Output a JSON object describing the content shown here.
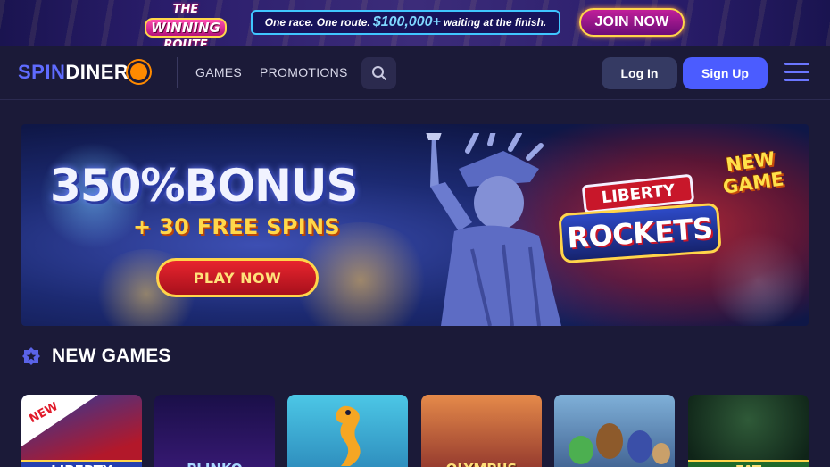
{
  "promo": {
    "logo_line1": "THE",
    "logo_line2": "WINNING",
    "logo_line3": "ROUTE",
    "tagline_before": "One race. One route.",
    "tagline_amount": "$100,000+",
    "tagline_after": "waiting at the finish.",
    "join_label": "JOIN NOW"
  },
  "header": {
    "brand_spin": "SPIN",
    "brand_dinero": "DINER",
    "nav": [
      {
        "label": "GAMES"
      },
      {
        "label": "PROMOTIONS"
      }
    ],
    "login_label": "Log In",
    "signup_label": "Sign Up"
  },
  "hero": {
    "bonus_text": "350%BONUS",
    "spins_text": "+ 30 FREE SPINS",
    "play_label": "PLAY NOW",
    "game_word1": "LIBERTY",
    "game_word2": "ROCKETS",
    "badge_line1": "NEW",
    "badge_line2": "GAME"
  },
  "section": {
    "title": "NEW GAMES"
  },
  "tiles": [
    {
      "label": "LIBERTY",
      "ribbon": "NEW",
      "color": "#b3182a"
    },
    {
      "label": "PLINKO",
      "color": "#1f1663"
    },
    {
      "label": "",
      "color": "#3bb6d9"
    },
    {
      "label": "OLYMPUS",
      "color": "#c8553a"
    },
    {
      "label": "",
      "color": "#5a86b0"
    },
    {
      "label": "FAT",
      "color": "#0f3320"
    }
  ],
  "icons": {
    "search": "search-icon",
    "menu": "hamburger-menu-icon",
    "section": "star-badge-icon"
  },
  "colors": {
    "accent": "#4b5cff",
    "background": "#1b1a38",
    "join_border": "#ffd54a"
  }
}
